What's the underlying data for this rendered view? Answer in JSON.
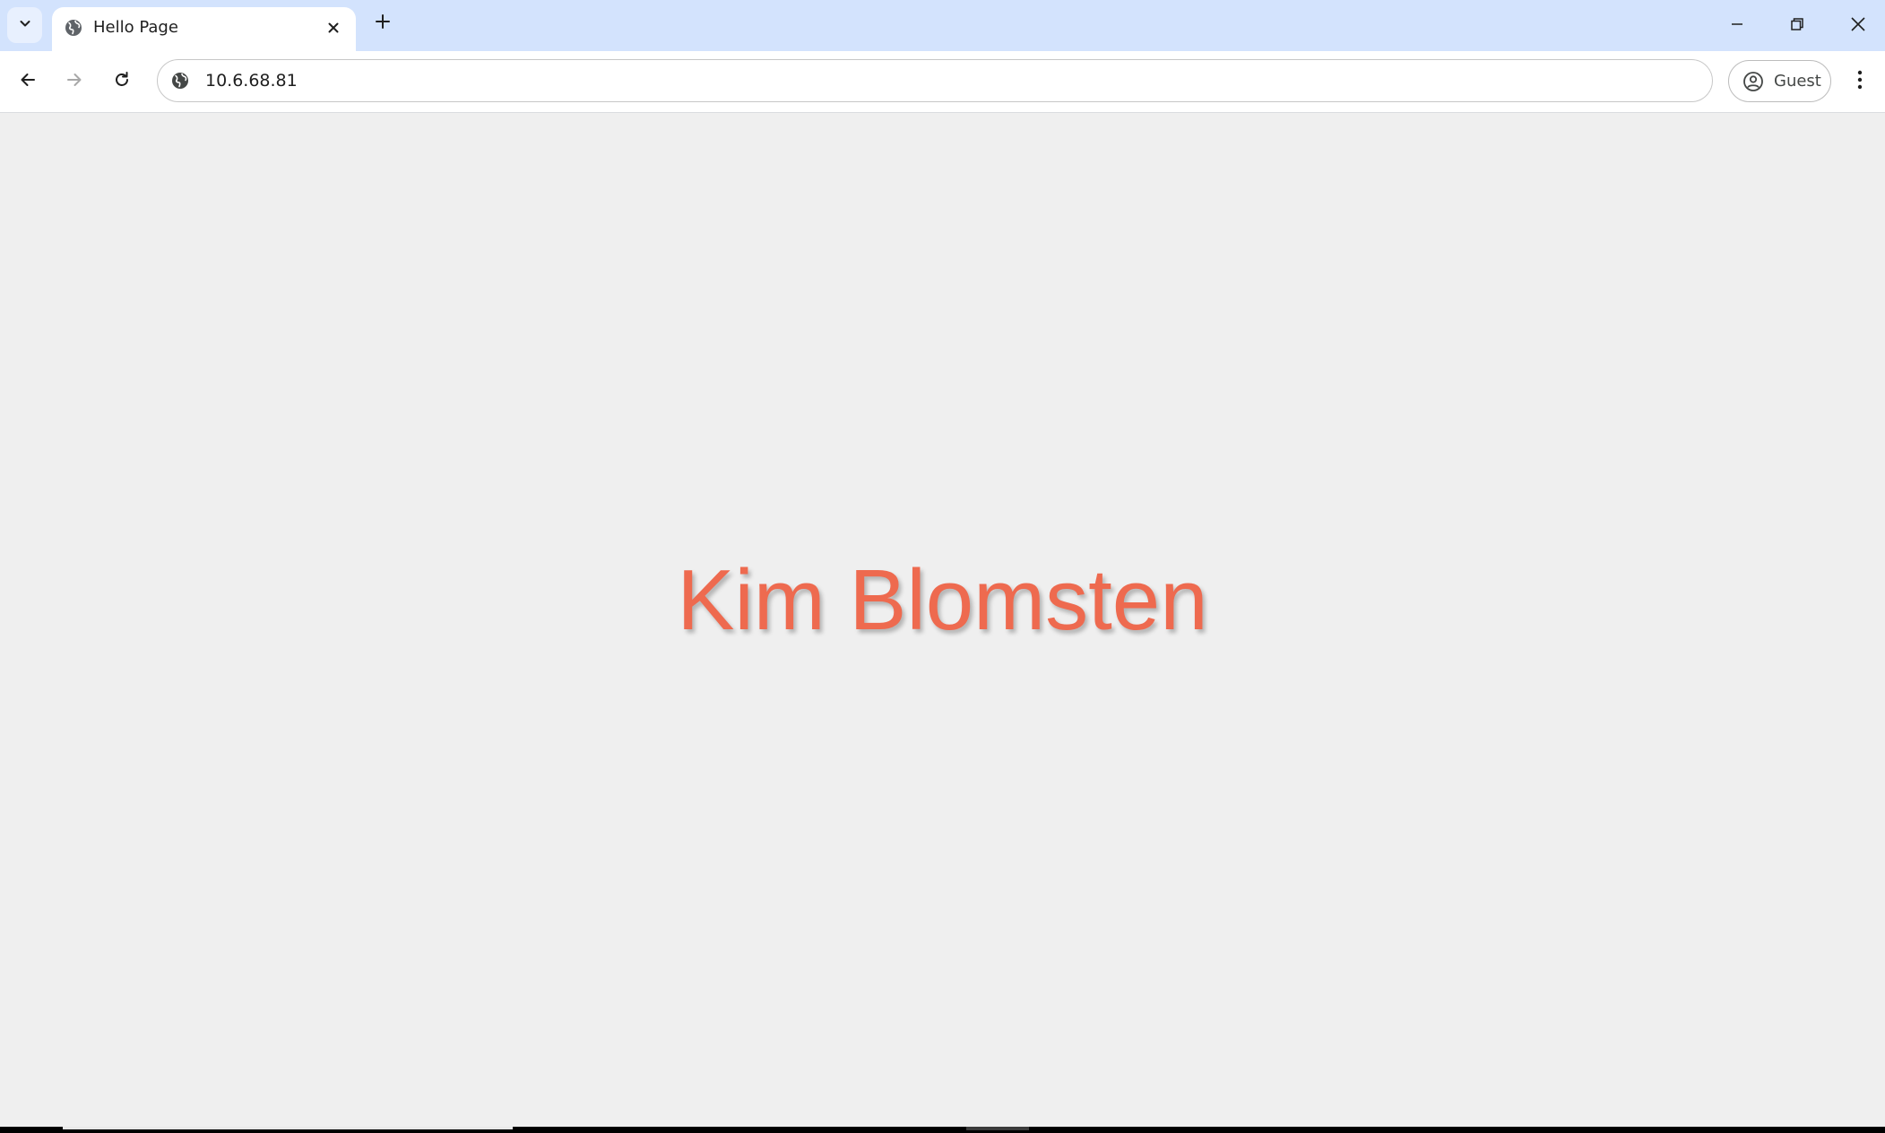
{
  "browser": {
    "tab_search_icon": "chevron-down-icon",
    "tabs": [
      {
        "title": "Hello Page",
        "favicon": "globe-icon",
        "close_icon": "close-icon",
        "active": true
      }
    ],
    "new_tab_icon": "plus-icon",
    "window_controls": {
      "minimize_icon": "minimize-icon",
      "restore_icon": "restore-icon",
      "close_icon": "close-icon"
    },
    "toolbar": {
      "back_icon": "arrow-left-icon",
      "forward_icon": "arrow-right-icon",
      "reload_icon": "reload-icon",
      "site_info_icon": "site-info-icon",
      "url": "10.6.68.81",
      "profile": {
        "icon": "person-circle-icon",
        "label": "Guest"
      },
      "menu_icon": "kebab-menu-icon"
    },
    "colors": {
      "tabstrip_bg": "#d3e3fd",
      "page_bg": "#efefef",
      "accent_text": "#ee6a4f"
    }
  },
  "page": {
    "heading": "Kim Blomsten"
  }
}
